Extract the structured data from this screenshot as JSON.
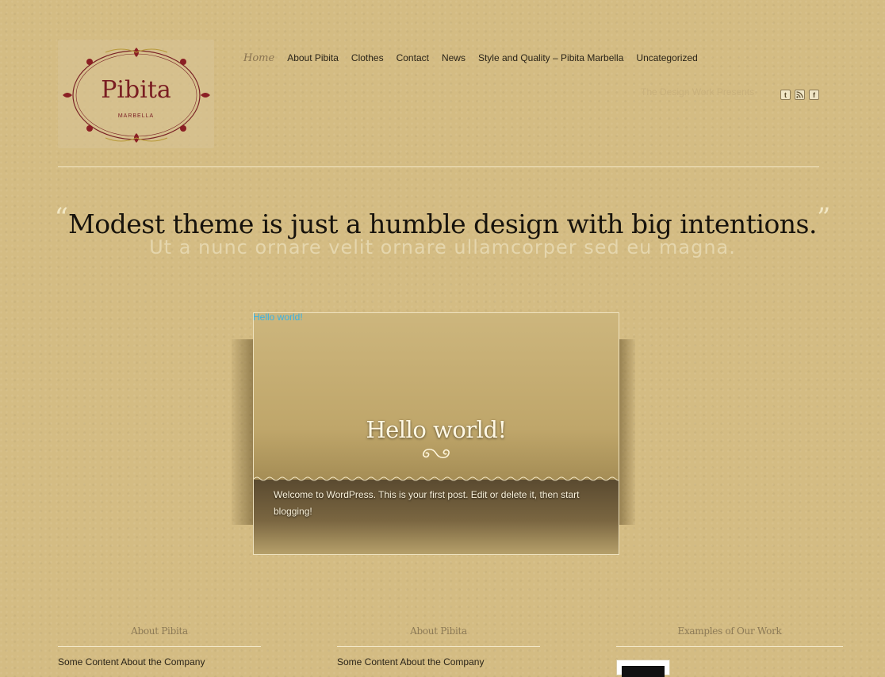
{
  "logo": {
    "name": "Pibita",
    "sub": "MARBELLA"
  },
  "nav": {
    "items": [
      {
        "label": "Home",
        "active": true
      },
      {
        "label": "About Pibita"
      },
      {
        "label": "Clothes"
      },
      {
        "label": "Contact"
      },
      {
        "label": "News"
      },
      {
        "label": "Style and Quality – Pibita Marbella"
      },
      {
        "label": "Uncategorized"
      }
    ]
  },
  "header": {
    "tagline": "The Design Work Presents",
    "social": [
      "twitter-icon",
      "rss-icon",
      "facebook-icon"
    ]
  },
  "headline": {
    "open_quote": "“",
    "text": "Modest theme is just a humble design with big intentions.",
    "close_quote": "”",
    "subtext": "Ut a nunc ornare velit ornare ullamcorper sed eu magna."
  },
  "post": {
    "link_label": "Hello world!",
    "title": "Hello world!",
    "excerpt": "Welcome to WordPress. This is your first post. Edit or delete it, then start blogging!"
  },
  "footer": {
    "widgets": [
      {
        "title": "About Pibita",
        "text": "Some Content About the Company"
      },
      {
        "title": "About Pibita",
        "text": "Some Content About the Company"
      },
      {
        "title": "Examples of Our Work"
      }
    ]
  },
  "colors": {
    "background": "#d4bc83",
    "link": "#38b3e6",
    "accent": "#8a7451"
  }
}
